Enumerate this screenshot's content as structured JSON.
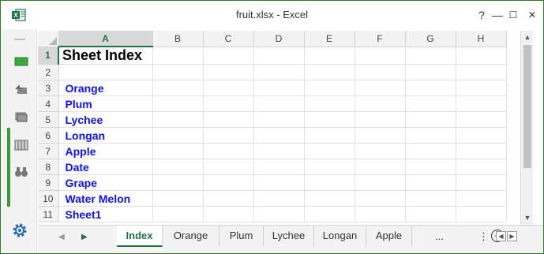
{
  "window": {
    "title": "fruit.xlsx - Excel",
    "controls": {
      "help": "?",
      "minimize": "—",
      "maximize": "☐",
      "close": "✕"
    }
  },
  "rail": {
    "icons": [
      "sheet-icon",
      "undo-icon",
      "layers-icon",
      "table-icon",
      "binoculars-icon"
    ],
    "settings_icon": "gear-icon"
  },
  "grid": {
    "columns": [
      "A",
      "B",
      "C",
      "D",
      "E",
      "F",
      "G",
      "H"
    ],
    "selected_column": "A",
    "selected_row": "1",
    "rows": [
      {
        "num": "1",
        "a": "Sheet Index",
        "style": "title"
      },
      {
        "num": "2",
        "a": "",
        "style": "plain"
      },
      {
        "num": "3",
        "a": "Orange",
        "style": "link"
      },
      {
        "num": "4",
        "a": "Plum",
        "style": "link"
      },
      {
        "num": "5",
        "a": "Lychee",
        "style": "link"
      },
      {
        "num": "6",
        "a": "Longan",
        "style": "link"
      },
      {
        "num": "7",
        "a": "Apple",
        "style": "link"
      },
      {
        "num": "8",
        "a": "Date",
        "style": "link"
      },
      {
        "num": "9",
        "a": "Grape",
        "style": "link"
      },
      {
        "num": "10",
        "a": "Water Melon",
        "style": "link"
      },
      {
        "num": "11",
        "a": "Sheet1",
        "style": "link"
      }
    ]
  },
  "tabs": {
    "items": [
      "Index",
      "Orange",
      "Plum",
      "Lychee",
      "Longan",
      "Apple"
    ],
    "active": "Index",
    "overflow_label": "...",
    "add_label": "+",
    "more_label": "⋮"
  },
  "colors": {
    "accent": "#217346",
    "link": "#1010e0",
    "rail_accent": "#3e9a3e"
  }
}
